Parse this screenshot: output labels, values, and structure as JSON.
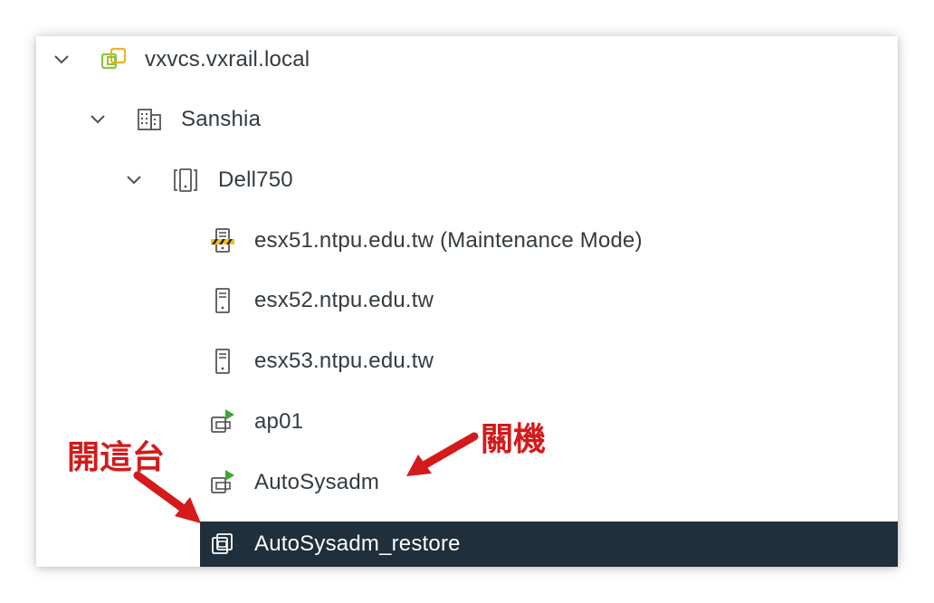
{
  "tree": {
    "vcenter": {
      "label": "vxvcs.vxrail.local",
      "icon": "vcenter-icon"
    },
    "datacenter": {
      "label": "Sanshia",
      "icon": "datacenter-building-icon"
    },
    "cluster": {
      "label": "Dell750",
      "icon": "cluster-icon"
    },
    "hosts": [
      {
        "label": "esx51.ntpu.edu.tw (Maintenance Mode)",
        "icon": "host-maintenance-icon"
      },
      {
        "label": "esx52.ntpu.edu.tw",
        "icon": "host-icon"
      },
      {
        "label": "esx53.ntpu.edu.tw",
        "icon": "host-icon"
      }
    ],
    "vms": [
      {
        "label": "ap01",
        "icon": "vm-powered-on-icon",
        "state": "powered-on"
      },
      {
        "label": "AutoSysadm",
        "icon": "vm-powered-on-icon",
        "state": "powered-on"
      },
      {
        "label": "AutoSysadm_restore",
        "icon": "vm-powered-off-icon",
        "state": "powered-off",
        "selected": true
      }
    ]
  },
  "annotations": {
    "power_off": "關機",
    "open_this": "開這台"
  },
  "colors": {
    "selected_bg": "#1f2f3b",
    "vcenter_green": "#89c540",
    "vcenter_yellow": "#f0b323",
    "power_green": "#3fa535",
    "annotation_red": "#d41a1a",
    "text": "#333b40"
  }
}
